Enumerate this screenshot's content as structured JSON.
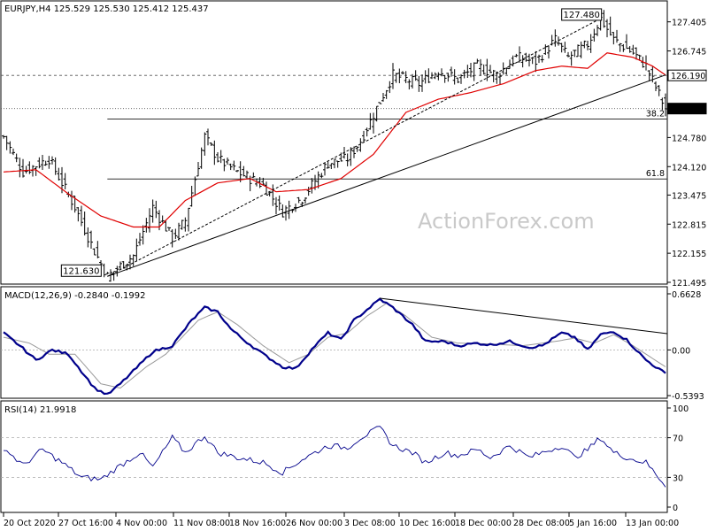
{
  "colors": {
    "price": "#000000",
    "sma": "#e00000",
    "macd": "#00008b",
    "signal": "#999999",
    "grid": "#aaaaaa",
    "watermark": "#c9c9c9"
  },
  "watermark": "ActionForex.com",
  "chart_data": [
    {
      "type": "bar",
      "title": "EURJPY,H4  125.529 125.530 125.412 125.437",
      "ylim": [
        121.495,
        127.74
      ],
      "yticks": [
        "127.405",
        "126.745",
        "126.190",
        "125.437",
        "124.780",
        "124.120",
        "123.475",
        "122.815",
        "122.155",
        "121.495"
      ],
      "xticks": [
        "20 Oct 2020",
        "27 Oct 16:00",
        "4 Nov 00:00",
        "11 Nov 08:00",
        "18 Nov 16:00",
        "26 Nov 00:00",
        "3 Dec 08:00",
        "10 Dec 16:00",
        "18 Dec 00:00",
        "28 Dec 08:00",
        "5 Jan 16:00",
        "13 Jan 00:00"
      ],
      "price_path": [
        [
          0,
          124.8
        ],
        [
          6,
          124.0
        ],
        [
          14,
          124.3
        ],
        [
          22,
          123.2
        ],
        [
          28,
          122.2
        ],
        [
          32,
          121.63
        ],
        [
          40,
          122.1
        ],
        [
          46,
          123.2
        ],
        [
          52,
          122.5
        ],
        [
          56,
          122.9
        ],
        [
          62,
          124.8
        ],
        [
          66,
          124.3
        ],
        [
          72,
          124.0
        ],
        [
          80,
          123.7
        ],
        [
          86,
          123.1
        ],
        [
          92,
          123.4
        ],
        [
          100,
          124.2
        ],
        [
          106,
          124.3
        ],
        [
          110,
          124.7
        ],
        [
          116,
          125.6
        ],
        [
          120,
          126.2
        ],
        [
          128,
          126.0
        ],
        [
          134,
          126.3
        ],
        [
          140,
          126.1
        ],
        [
          146,
          126.4
        ],
        [
          152,
          126.2
        ],
        [
          158,
          126.6
        ],
        [
          164,
          126.5
        ],
        [
          170,
          127.0
        ],
        [
          174,
          126.6
        ],
        [
          180,
          126.9
        ],
        [
          184,
          127.48
        ],
        [
          188,
          127.0
        ],
        [
          194,
          126.7
        ],
        [
          198,
          126.4
        ],
        [
          204,
          125.437
        ]
      ],
      "sma_path": [
        [
          0,
          124.0
        ],
        [
          10,
          124.05
        ],
        [
          20,
          123.5
        ],
        [
          30,
          123.0
        ],
        [
          40,
          122.75
        ],
        [
          48,
          122.75
        ],
        [
          56,
          123.35
        ],
        [
          66,
          123.75
        ],
        [
          76,
          123.85
        ],
        [
          84,
          123.55
        ],
        [
          94,
          123.6
        ],
        [
          104,
          123.85
        ],
        [
          114,
          124.4
        ],
        [
          124,
          125.35
        ],
        [
          134,
          125.65
        ],
        [
          144,
          125.8
        ],
        [
          154,
          126.0
        ],
        [
          164,
          126.3
        ],
        [
          172,
          126.4
        ],
        [
          180,
          126.35
        ],
        [
          186,
          126.7
        ],
        [
          194,
          126.6
        ],
        [
          200,
          126.4
        ],
        [
          204,
          126.2
        ]
      ],
      "horizontal_levels": [
        {
          "value": 126.19,
          "style": "dashed",
          "label": "126.190"
        },
        {
          "value": 125.437,
          "style": "dotted",
          "label": "125.437"
        }
      ],
      "fib_levels": [
        {
          "value": 125.2,
          "label": "38.2"
        },
        {
          "value": 123.84,
          "label": "61.8"
        }
      ],
      "trendlines": [
        {
          "from": [
            32,
            121.63
          ],
          "to": [
            204,
            126.2
          ],
          "style": "solid"
        },
        {
          "from": [
            32,
            121.63
          ],
          "to": [
            184,
            127.48
          ],
          "style": "dashed"
        }
      ],
      "annotations": [
        {
          "text": "121.630",
          "x": 32,
          "y": 121.63
        },
        {
          "text": "127.480",
          "x": 184,
          "y": 127.48
        }
      ],
      "last_value": "125.437"
    },
    {
      "type": "line",
      "title": "MACD(12,26,9) -0.2840 -0.1992",
      "ylim": [
        -0.5393,
        0.6628
      ],
      "yticks": [
        "0.6628",
        "0.00",
        "-0.5393"
      ],
      "series": [
        {
          "name": "MACD",
          "points": [
            [
              0,
              0.2
            ],
            [
              5,
              0.05
            ],
            [
              10,
              -0.12
            ],
            [
              15,
              0.0
            ],
            [
              20,
              -0.05
            ],
            [
              28,
              -0.45
            ],
            [
              32,
              -0.53
            ],
            [
              36,
              -0.4
            ],
            [
              40,
              -0.25
            ],
            [
              46,
              -0.02
            ],
            [
              52,
              0.05
            ],
            [
              58,
              0.35
            ],
            [
              62,
              0.5
            ],
            [
              66,
              0.45
            ],
            [
              70,
              0.25
            ],
            [
              74,
              0.12
            ],
            [
              80,
              -0.05
            ],
            [
              86,
              -0.2
            ],
            [
              90,
              -0.22
            ],
            [
              96,
              0.05
            ],
            [
              100,
              0.2
            ],
            [
              104,
              0.12
            ],
            [
              108,
              0.35
            ],
            [
              116,
              0.6
            ],
            [
              120,
              0.5
            ],
            [
              126,
              0.3
            ],
            [
              130,
              0.1
            ],
            [
              136,
              0.1
            ],
            [
              140,
              0.05
            ],
            [
              146,
              0.08
            ],
            [
              150,
              0.06
            ],
            [
              156,
              0.1
            ],
            [
              162,
              0.03
            ],
            [
              166,
              0.05
            ],
            [
              172,
              0.2
            ],
            [
              176,
              0.15
            ],
            [
              180,
              0.0
            ],
            [
              184,
              0.18
            ],
            [
              188,
              0.22
            ],
            [
              192,
              0.12
            ],
            [
              198,
              -0.12
            ],
            [
              204,
              -0.28
            ]
          ]
        },
        {
          "name": "Signal",
          "points": [
            [
              0,
              0.15
            ],
            [
              8,
              0.08
            ],
            [
              14,
              -0.05
            ],
            [
              22,
              -0.05
            ],
            [
              30,
              -0.4
            ],
            [
              36,
              -0.45
            ],
            [
              44,
              -0.2
            ],
            [
              50,
              -0.05
            ],
            [
              60,
              0.35
            ],
            [
              66,
              0.45
            ],
            [
              72,
              0.3
            ],
            [
              80,
              0.05
            ],
            [
              88,
              -0.15
            ],
            [
              94,
              -0.05
            ],
            [
              100,
              0.15
            ],
            [
              106,
              0.2
            ],
            [
              112,
              0.4
            ],
            [
              118,
              0.55
            ],
            [
              124,
              0.4
            ],
            [
              132,
              0.15
            ],
            [
              140,
              0.08
            ],
            [
              150,
              0.07
            ],
            [
              160,
              0.05
            ],
            [
              170,
              0.1
            ],
            [
              176,
              0.14
            ],
            [
              182,
              0.08
            ],
            [
              188,
              0.18
            ],
            [
              194,
              0.05
            ],
            [
              204,
              -0.2
            ]
          ]
        }
      ],
      "trendlines": [
        {
          "from": [
            116,
            0.61
          ],
          "to": [
            220,
            0.12
          ],
          "style": "solid"
        }
      ],
      "zero_line": true
    },
    {
      "type": "line",
      "title": "RSI(14) 21.9918",
      "ylim": [
        0,
        100
      ],
      "yticks": [
        "100",
        "70",
        "30",
        "0"
      ],
      "levels": [
        70,
        30
      ],
      "series": [
        {
          "name": "RSI",
          "points": [
            [
              0,
              60
            ],
            [
              6,
              42
            ],
            [
              12,
              58
            ],
            [
              18,
              45
            ],
            [
              24,
              30
            ],
            [
              30,
              28
            ],
            [
              36,
              42
            ],
            [
              42,
              55
            ],
            [
              46,
              40
            ],
            [
              52,
              70
            ],
            [
              56,
              55
            ],
            [
              62,
              72
            ],
            [
              66,
              55
            ],
            [
              72,
              50
            ],
            [
              80,
              45
            ],
            [
              86,
              35
            ],
            [
              92,
              48
            ],
            [
              100,
              62
            ],
            [
              106,
              60
            ],
            [
              110,
              70
            ],
            [
              116,
              80
            ],
            [
              120,
              62
            ],
            [
              126,
              55
            ],
            [
              130,
              45
            ],
            [
              136,
              55
            ],
            [
              140,
              52
            ],
            [
              146,
              58
            ],
            [
              150,
              50
            ],
            [
              156,
              62
            ],
            [
              162,
              50
            ],
            [
              166,
              55
            ],
            [
              172,
              62
            ],
            [
              176,
              50
            ],
            [
              180,
              58
            ],
            [
              184,
              70
            ],
            [
              188,
              55
            ],
            [
              194,
              48
            ],
            [
              198,
              45
            ],
            [
              204,
              22
            ]
          ]
        }
      ]
    }
  ]
}
